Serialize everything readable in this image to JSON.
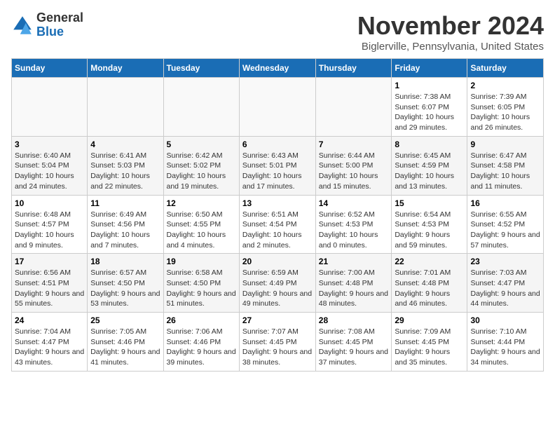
{
  "header": {
    "logo_line1": "General",
    "logo_line2": "Blue",
    "month_title": "November 2024",
    "subtitle": "Biglerville, Pennsylvania, United States"
  },
  "weekdays": [
    "Sunday",
    "Monday",
    "Tuesday",
    "Wednesday",
    "Thursday",
    "Friday",
    "Saturday"
  ],
  "weeks": [
    [
      {
        "day": "",
        "info": ""
      },
      {
        "day": "",
        "info": ""
      },
      {
        "day": "",
        "info": ""
      },
      {
        "day": "",
        "info": ""
      },
      {
        "day": "",
        "info": ""
      },
      {
        "day": "1",
        "info": "Sunrise: 7:38 AM\nSunset: 6:07 PM\nDaylight: 10 hours and 29 minutes."
      },
      {
        "day": "2",
        "info": "Sunrise: 7:39 AM\nSunset: 6:05 PM\nDaylight: 10 hours and 26 minutes."
      }
    ],
    [
      {
        "day": "3",
        "info": "Sunrise: 6:40 AM\nSunset: 5:04 PM\nDaylight: 10 hours and 24 minutes."
      },
      {
        "day": "4",
        "info": "Sunrise: 6:41 AM\nSunset: 5:03 PM\nDaylight: 10 hours and 22 minutes."
      },
      {
        "day": "5",
        "info": "Sunrise: 6:42 AM\nSunset: 5:02 PM\nDaylight: 10 hours and 19 minutes."
      },
      {
        "day": "6",
        "info": "Sunrise: 6:43 AM\nSunset: 5:01 PM\nDaylight: 10 hours and 17 minutes."
      },
      {
        "day": "7",
        "info": "Sunrise: 6:44 AM\nSunset: 5:00 PM\nDaylight: 10 hours and 15 minutes."
      },
      {
        "day": "8",
        "info": "Sunrise: 6:45 AM\nSunset: 4:59 PM\nDaylight: 10 hours and 13 minutes."
      },
      {
        "day": "9",
        "info": "Sunrise: 6:47 AM\nSunset: 4:58 PM\nDaylight: 10 hours and 11 minutes."
      }
    ],
    [
      {
        "day": "10",
        "info": "Sunrise: 6:48 AM\nSunset: 4:57 PM\nDaylight: 10 hours and 9 minutes."
      },
      {
        "day": "11",
        "info": "Sunrise: 6:49 AM\nSunset: 4:56 PM\nDaylight: 10 hours and 7 minutes."
      },
      {
        "day": "12",
        "info": "Sunrise: 6:50 AM\nSunset: 4:55 PM\nDaylight: 10 hours and 4 minutes."
      },
      {
        "day": "13",
        "info": "Sunrise: 6:51 AM\nSunset: 4:54 PM\nDaylight: 10 hours and 2 minutes."
      },
      {
        "day": "14",
        "info": "Sunrise: 6:52 AM\nSunset: 4:53 PM\nDaylight: 10 hours and 0 minutes."
      },
      {
        "day": "15",
        "info": "Sunrise: 6:54 AM\nSunset: 4:53 PM\nDaylight: 9 hours and 59 minutes."
      },
      {
        "day": "16",
        "info": "Sunrise: 6:55 AM\nSunset: 4:52 PM\nDaylight: 9 hours and 57 minutes."
      }
    ],
    [
      {
        "day": "17",
        "info": "Sunrise: 6:56 AM\nSunset: 4:51 PM\nDaylight: 9 hours and 55 minutes."
      },
      {
        "day": "18",
        "info": "Sunrise: 6:57 AM\nSunset: 4:50 PM\nDaylight: 9 hours and 53 minutes."
      },
      {
        "day": "19",
        "info": "Sunrise: 6:58 AM\nSunset: 4:50 PM\nDaylight: 9 hours and 51 minutes."
      },
      {
        "day": "20",
        "info": "Sunrise: 6:59 AM\nSunset: 4:49 PM\nDaylight: 9 hours and 49 minutes."
      },
      {
        "day": "21",
        "info": "Sunrise: 7:00 AM\nSunset: 4:48 PM\nDaylight: 9 hours and 48 minutes."
      },
      {
        "day": "22",
        "info": "Sunrise: 7:01 AM\nSunset: 4:48 PM\nDaylight: 9 hours and 46 minutes."
      },
      {
        "day": "23",
        "info": "Sunrise: 7:03 AM\nSunset: 4:47 PM\nDaylight: 9 hours and 44 minutes."
      }
    ],
    [
      {
        "day": "24",
        "info": "Sunrise: 7:04 AM\nSunset: 4:47 PM\nDaylight: 9 hours and 43 minutes."
      },
      {
        "day": "25",
        "info": "Sunrise: 7:05 AM\nSunset: 4:46 PM\nDaylight: 9 hours and 41 minutes."
      },
      {
        "day": "26",
        "info": "Sunrise: 7:06 AM\nSunset: 4:46 PM\nDaylight: 9 hours and 39 minutes."
      },
      {
        "day": "27",
        "info": "Sunrise: 7:07 AM\nSunset: 4:45 PM\nDaylight: 9 hours and 38 minutes."
      },
      {
        "day": "28",
        "info": "Sunrise: 7:08 AM\nSunset: 4:45 PM\nDaylight: 9 hours and 37 minutes."
      },
      {
        "day": "29",
        "info": "Sunrise: 7:09 AM\nSunset: 4:45 PM\nDaylight: 9 hours and 35 minutes."
      },
      {
        "day": "30",
        "info": "Sunrise: 7:10 AM\nSunset: 4:44 PM\nDaylight: 9 hours and 34 minutes."
      }
    ]
  ]
}
